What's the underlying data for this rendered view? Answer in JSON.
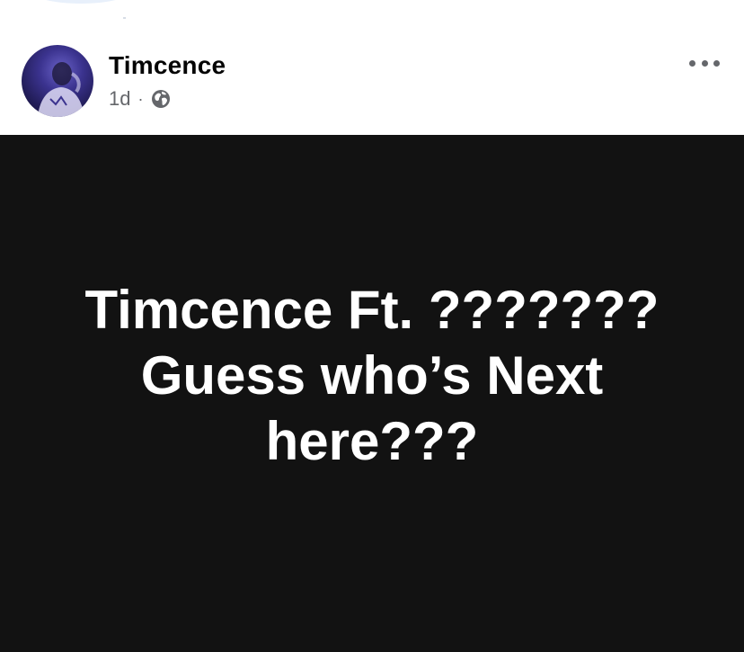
{
  "post": {
    "author": {
      "name": "Timcence"
    },
    "time": "1d",
    "separator": "·",
    "audience_icon": "globe-icon",
    "more_icon": "more-horizontal-icon",
    "status": {
      "text": "Timcence Ft. ???????\nGuess who’s Next\nhere???",
      "background_color": "#121212",
      "text_color": "#ffffff"
    }
  },
  "colors": {
    "primary_text": "#050505",
    "secondary_text": "#65676b",
    "background": "#ffffff"
  }
}
